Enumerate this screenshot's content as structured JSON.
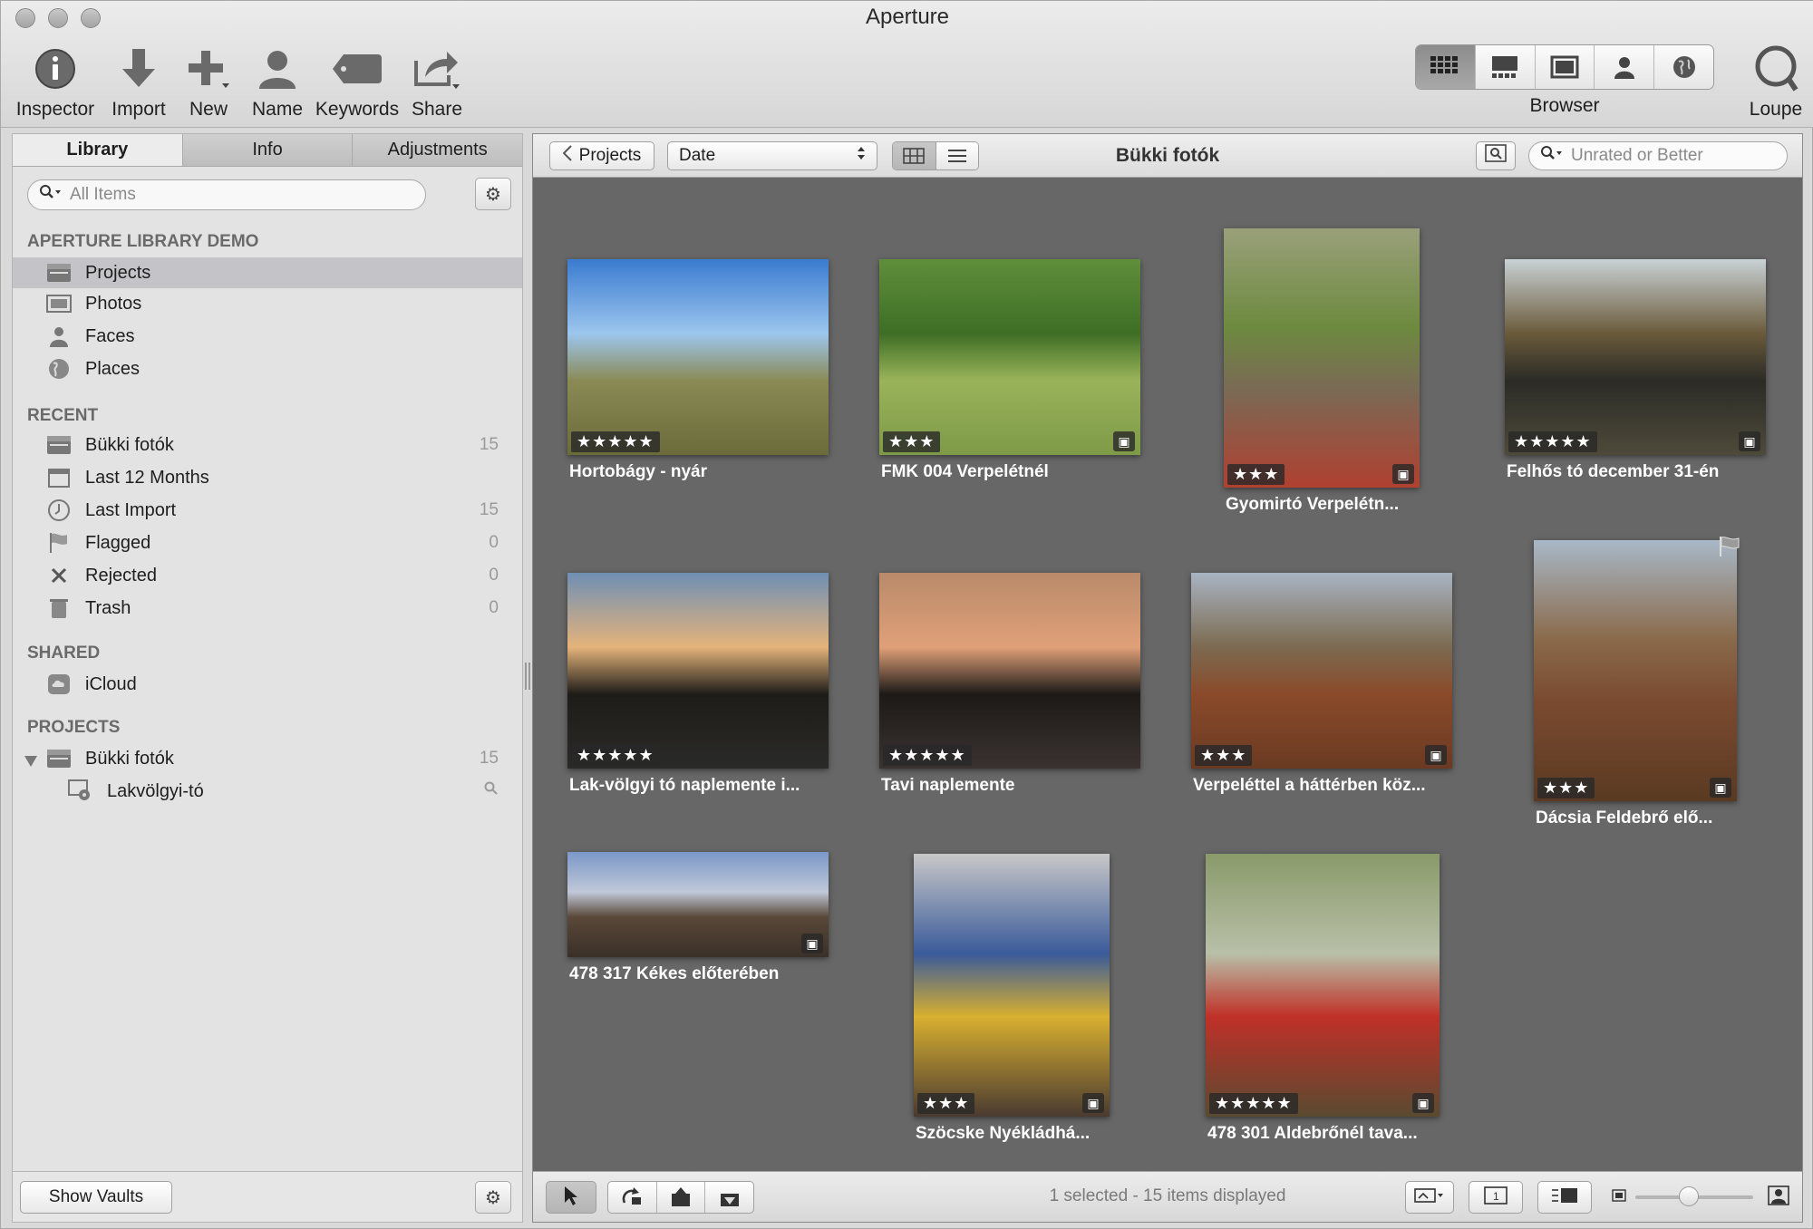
{
  "window": {
    "title": "Aperture"
  },
  "toolbar": {
    "items": [
      {
        "label": "Inspector",
        "icon": "info-icon"
      },
      {
        "label": "Import",
        "icon": "import-arrow-icon"
      },
      {
        "label": "New",
        "icon": "plus-icon"
      },
      {
        "label": "Name",
        "icon": "person-icon"
      },
      {
        "label": "Keywords",
        "icon": "tag-icon"
      },
      {
        "label": "Share",
        "icon": "share-icon"
      }
    ],
    "browser_label": "Browser",
    "loupe_label": "Loupe",
    "view_modes": [
      "grid-view-icon",
      "filmstrip-view-icon",
      "viewer-icon",
      "faces-icon",
      "places-icon"
    ],
    "active_view": 0
  },
  "sidebar": {
    "tabs": [
      "Library",
      "Info",
      "Adjustments"
    ],
    "active_tab": "Library",
    "search_placeholder": "All Items",
    "library_header": "APERTURE LIBRARY DEMO",
    "library_items": [
      {
        "label": "Projects",
        "icon": "projects-icon",
        "selected": true
      },
      {
        "label": "Photos",
        "icon": "photos-icon"
      },
      {
        "label": "Faces",
        "icon": "faces-icon"
      },
      {
        "label": "Places",
        "icon": "globe-icon"
      }
    ],
    "recent_header": "RECENT",
    "recent_items": [
      {
        "label": "Bükki fotók",
        "count": "15",
        "icon": "project-box-icon"
      },
      {
        "label": "Last 12 Months",
        "count": "",
        "icon": "calendar-icon"
      },
      {
        "label": "Last Import",
        "count": "15",
        "icon": "clock-icon"
      },
      {
        "label": "Flagged",
        "count": "0",
        "icon": "flag-icon"
      },
      {
        "label": "Rejected",
        "count": "0",
        "icon": "x-icon"
      },
      {
        "label": "Trash",
        "count": "0",
        "icon": "trash-icon"
      }
    ],
    "shared_header": "SHARED",
    "shared_items": [
      {
        "label": "iCloud",
        "icon": "icloud-icon"
      }
    ],
    "projects_header": "PROJECTS",
    "project_items": [
      {
        "label": "Bükki fotók",
        "count": "15",
        "icon": "project-box-icon"
      },
      {
        "label": "Lakvölgyi-tó",
        "count": "",
        "icon": "smart-album-icon"
      }
    ],
    "show_vaults": "Show Vaults"
  },
  "browser": {
    "back_button": "Projects",
    "sort": "Date",
    "title": "Bükki fotók",
    "filter": "Unrated or Better",
    "status": "1 selected - 15 items displayed",
    "photos": [
      {
        "caption": "Hortobágy - nyár",
        "stars": "★★★★★",
        "badge": false,
        "palette": [
          "#3a7bd0",
          "#9cc6ee",
          "#8a8a55",
          "#6b6b3a"
        ]
      },
      {
        "caption": "FMK 004 Verpelétnél",
        "stars": "★★★",
        "badge": true,
        "palette": [
          "#5f8f3a",
          "#3e6e25",
          "#9ab35a",
          "#7e9a48"
        ]
      },
      {
        "caption": "Gyomirtó Verpelétn...",
        "stars": "★★★",
        "badge": true,
        "palette": [
          "#9aa07a",
          "#6d8a3f",
          "#7a6a55",
          "#b04030"
        ]
      },
      {
        "caption": "Felhős tó december 31-én",
        "stars": "★★★★★",
        "badge": true,
        "palette": [
          "#c9d2d6",
          "#6a5a3a",
          "#2b2b26",
          "#4e4a3a"
        ]
      },
      {
        "caption": "Lak-völgyi tó naplemente i...",
        "stars": "★★★★★",
        "badge": false,
        "palette": [
          "#6f8fb5",
          "#e4b37a",
          "#1e1c18",
          "#2a2a28"
        ]
      },
      {
        "caption": "Tavi naplemente",
        "stars": "★★★★★",
        "badge": false,
        "palette": [
          "#b98a6a",
          "#e0a078",
          "#1d1a18",
          "#3a3230"
        ]
      },
      {
        "caption": "Verpeléttel a háttérben köz...",
        "stars": "★★★",
        "badge": true,
        "palette": [
          "#a8b4c2",
          "#7c6a50",
          "#8a4a2a",
          "#6a3a22"
        ]
      },
      {
        "caption": "Dácsia Feldebrő elő...",
        "stars": "★★★",
        "badge": true,
        "palette": [
          "#a8b8c8",
          "#8a6a4a",
          "#7a4a30",
          "#5a3a22"
        ]
      },
      {
        "caption": "478 317 Kékes előterében",
        "stars": "",
        "badge": true,
        "palette": [
          "#7a98c8",
          "#c0c8d8",
          "#5a4838",
          "#3a3028"
        ]
      },
      {
        "caption": "Szöcske Nyékládhá...",
        "stars": "★★★",
        "badge": true,
        "palette": [
          "#c8c8c8",
          "#3a5a9a",
          "#d8b030",
          "#4a3a30"
        ]
      },
      {
        "caption": "478 301 Aldebrőnél tava...",
        "stars": "★★★★★",
        "badge": true,
        "palette": [
          "#8a9a6a",
          "#b8c0a8",
          "#c03028",
          "#5a4a30"
        ]
      }
    ]
  }
}
